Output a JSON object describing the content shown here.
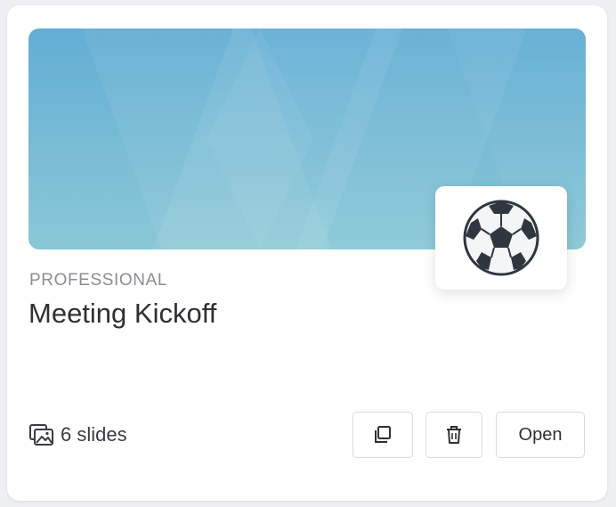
{
  "card": {
    "category": "PROFESSIONAL",
    "title": "Meeting Kickoff",
    "emoji_icon": "soccer-ball-icon",
    "banner_color": "#6fb5d7",
    "slide_count_label": "6 slides",
    "slides_icon": "images-icon",
    "actions": {
      "duplicate_icon": "duplicate-icon",
      "delete_icon": "trash-icon",
      "open_label": "Open"
    }
  }
}
